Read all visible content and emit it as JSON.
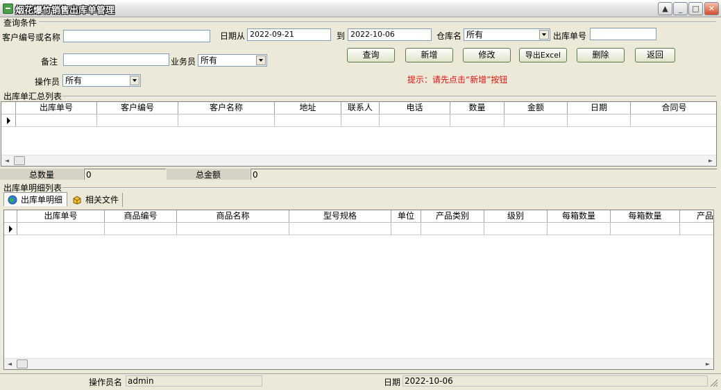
{
  "window": {
    "title": "烟花爆竹销售出库单管理",
    "minimize_label": "_",
    "maximize_label": "□",
    "close_label": "✕"
  },
  "query": {
    "group_label": "查询条件",
    "customer_label": "客户编号或名称",
    "customer_value": "",
    "date_from_label": "日期从",
    "date_from_value": "2022-09-21",
    "date_to_label": "到",
    "date_to_value": "2022-10-06",
    "warehouse_label": "仓库名",
    "warehouse_value": "所有",
    "out_no_label": "出库单号",
    "out_no_value": "",
    "remark_label": "备注",
    "remark_value": "",
    "salesman_label": "业务员",
    "salesman_value": "所有",
    "operator_label": "操作员",
    "operator_value": "所有"
  },
  "buttons": {
    "search": "查询",
    "add": "新增",
    "edit": "修改",
    "export": "导出Excel",
    "delete": "删除",
    "back": "返回"
  },
  "hint": "提示：请先点击“新增”按钮",
  "summary_grid": {
    "group_label": "出库单汇总列表",
    "columns": [
      "出库单号",
      "客户编号",
      "客户名称",
      "地址",
      "联系人",
      "电话",
      "数量",
      "金额",
      "日期",
      "合同号"
    ]
  },
  "totals": {
    "qty_label": "总数量",
    "qty_value": "0",
    "amount_label": "总金额",
    "amount_value": "0"
  },
  "detail": {
    "group_label": "出库单明细列表",
    "tabs": [
      {
        "label": "出库单明细",
        "icon": "globe-icon"
      },
      {
        "label": "相关文件",
        "icon": "box-icon"
      }
    ],
    "columns": [
      "出库单号",
      "商品编号",
      "商品名称",
      "型号规格",
      "单位",
      "产品类别",
      "级别",
      "每箱数量",
      "每箱数量",
      "产品"
    ]
  },
  "status": {
    "operator_label": "操作员名",
    "operator_value": "admin",
    "date_label": "日期",
    "date_value": "2022-10-06"
  },
  "colors": {
    "hint": "#e01010",
    "background": "#ece9d8"
  }
}
